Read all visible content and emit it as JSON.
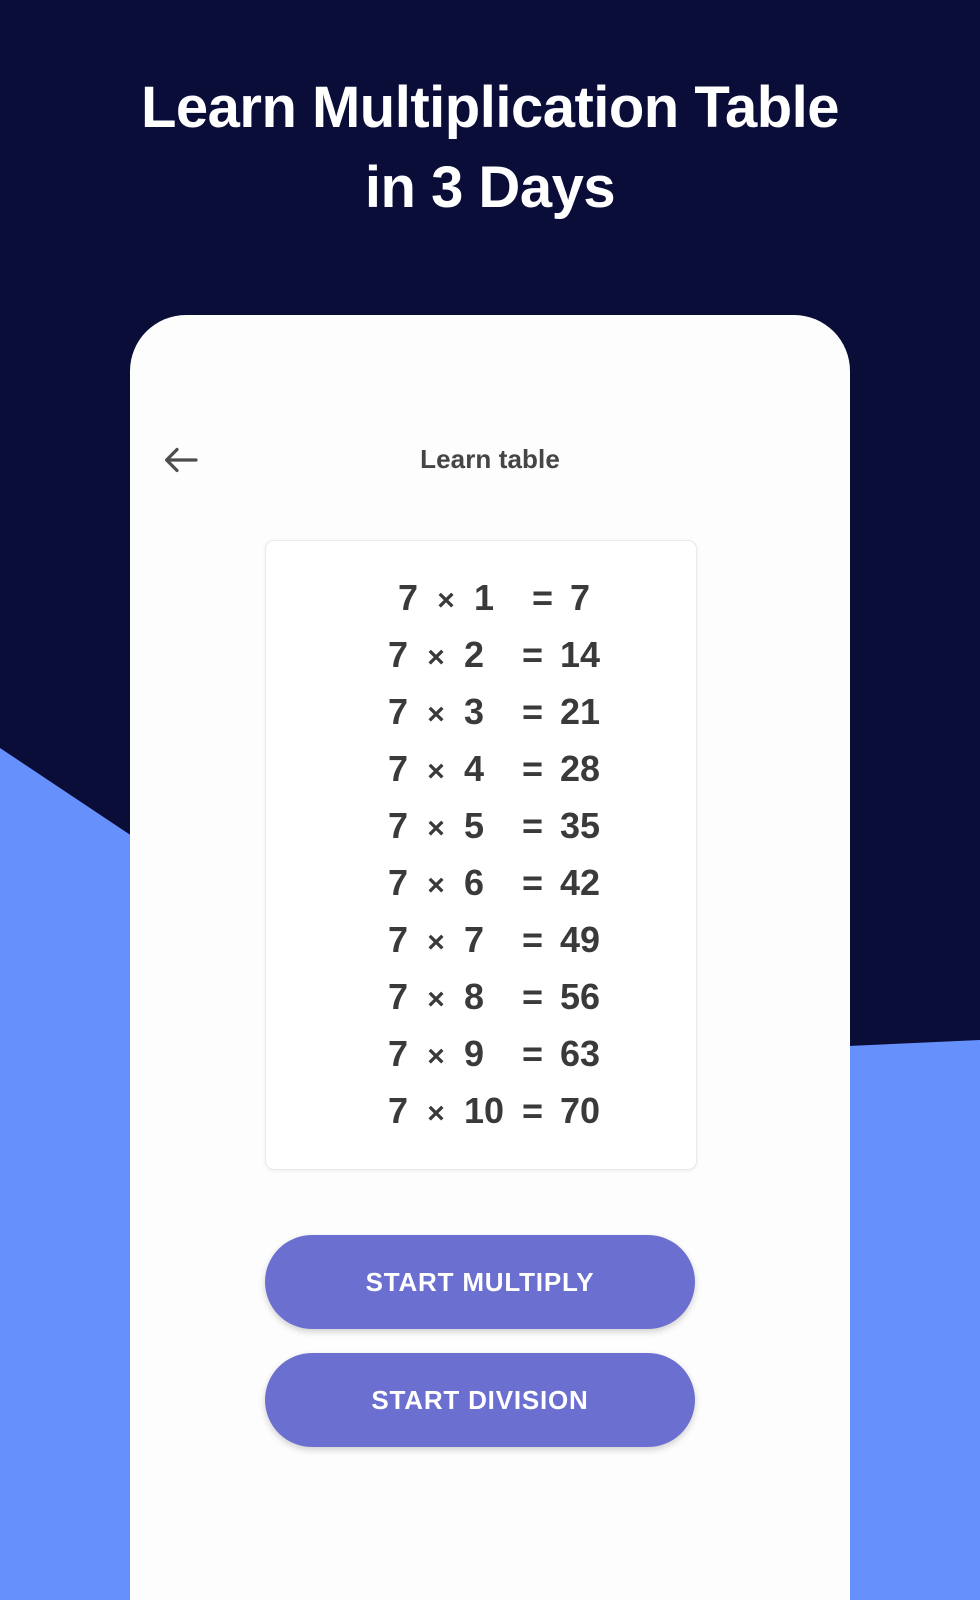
{
  "promo": {
    "headline_line1": "Learn Multiplication Table",
    "headline_line2": "in 3 Days"
  },
  "colors": {
    "background_dark": "#0a0d38",
    "background_blue": "#6690fb",
    "button": "#6b6fd0",
    "phone_screen": "#fdfdfd",
    "text_dark": "#3a3a3a",
    "appbar_title": "#454545"
  },
  "app": {
    "appbar": {
      "back_icon": "arrow-left-icon",
      "title": "Learn table"
    },
    "table_card": {
      "multiplier": "7",
      "operator": "×",
      "equals": "=",
      "rows": [
        {
          "a": "7",
          "op": "×",
          "b": "1",
          "eq": "=",
          "result": "7"
        },
        {
          "a": "7",
          "op": "×",
          "b": "2",
          "eq": "=",
          "result": "14"
        },
        {
          "a": "7",
          "op": "×",
          "b": "3",
          "eq": "=",
          "result": "21"
        },
        {
          "a": "7",
          "op": "×",
          "b": "4",
          "eq": "=",
          "result": "28"
        },
        {
          "a": "7",
          "op": "×",
          "b": "5",
          "eq": "=",
          "result": "35"
        },
        {
          "a": "7",
          "op": "×",
          "b": "6",
          "eq": "=",
          "result": "42"
        },
        {
          "a": "7",
          "op": "×",
          "b": "7",
          "eq": "=",
          "result": "49"
        },
        {
          "a": "7",
          "op": "×",
          "b": "8",
          "eq": "=",
          "result": "56"
        },
        {
          "a": "7",
          "op": "×",
          "b": "9",
          "eq": "=",
          "result": "63"
        },
        {
          "a": "7",
          "op": "×",
          "b": "10",
          "eq": "=",
          "result": "70"
        }
      ]
    },
    "actions": {
      "multiply_label": "START MULTIPLY",
      "division_label": "START DIVISION"
    }
  }
}
